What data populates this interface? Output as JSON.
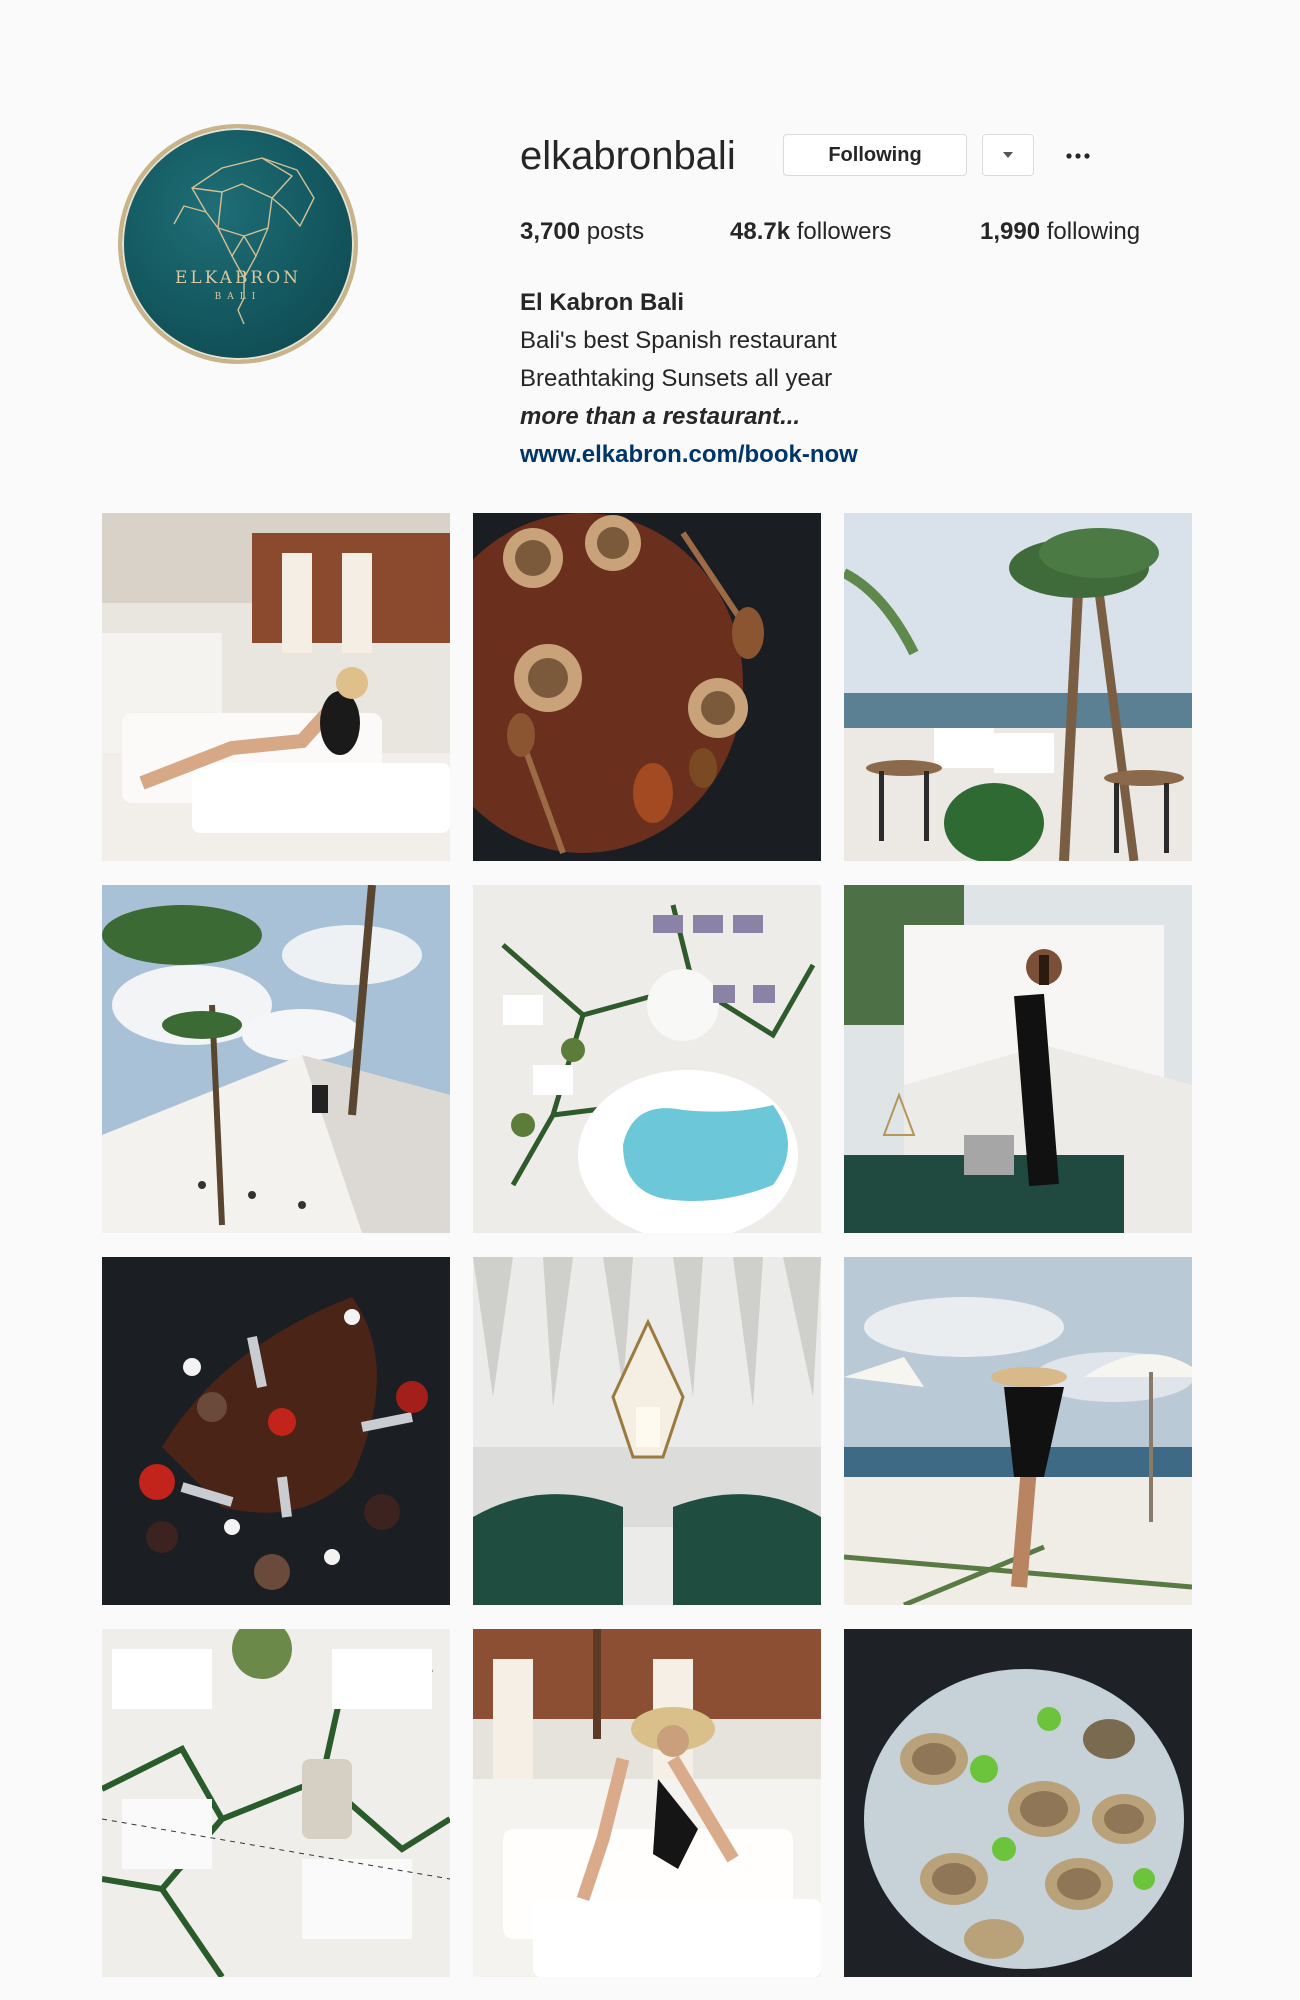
{
  "profile": {
    "username": "elkabronbali",
    "avatar_brand": "ELKABRON",
    "avatar_sub": "BALI",
    "following_button": "Following",
    "dropdown_icon": "chevron-down-icon",
    "more_icon": "ellipsis-icon",
    "stats": {
      "posts_count": "3,700",
      "posts_label": "posts",
      "followers_count": "48.7k",
      "followers_label": "followers",
      "following_count": "1,990",
      "following_label": "following"
    },
    "bio": {
      "name": "El Kabron Bali",
      "line1": "Bali's best Spanish restaurant",
      "line2": "Breathtaking Sunsets all year",
      "tagline": "more than a restaurant...",
      "link": "www.elkabron.com/book-now"
    }
  },
  "colors": {
    "avatar_teal": "#155b63",
    "avatar_gold": "#c9b48a",
    "link_blue": "#003569",
    "background": "#fafafa"
  },
  "posts": [
    {
      "id": "post-1",
      "subject": "woman lounging on white daybed"
    },
    {
      "id": "post-2",
      "subject": "seafood paella with spoons"
    },
    {
      "id": "post-3",
      "subject": "terrace with palm trees and ocean"
    },
    {
      "id": "post-4",
      "subject": "white stairs under palm trees"
    },
    {
      "id": "post-5",
      "subject": "aerial view of pool and loungers"
    },
    {
      "id": "post-6",
      "subject": "woman in black dress on white steps"
    },
    {
      "id": "post-7",
      "subject": "tapas dish on dark slate"
    },
    {
      "id": "post-8",
      "subject": "geometric lantern between green cushions"
    },
    {
      "id": "post-9",
      "subject": "woman in hat facing the ocean"
    },
    {
      "id": "post-10",
      "subject": "aerial view of lounge area"
    },
    {
      "id": "post-11",
      "subject": "woman in straw hat on daybed"
    },
    {
      "id": "post-12",
      "subject": "oysters on ice with limes"
    }
  ]
}
